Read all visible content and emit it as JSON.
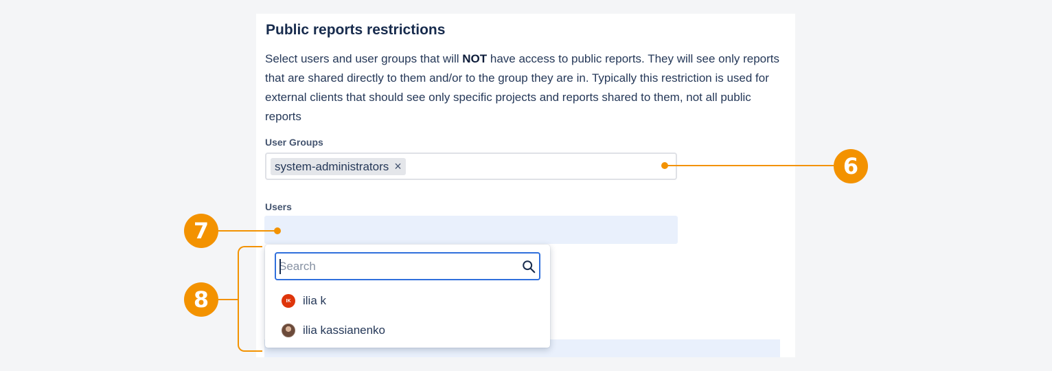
{
  "section": {
    "title": "Public reports restrictions",
    "desc_part1": "Select users and user groups that will ",
    "desc_bold": "NOT",
    "desc_part2": " have access to public reports. They will see only reports that are shared directly to them and/or to the group they are in. Typically this restriction is used for external clients that should see only specific projects and reports shared to them, not all public reports"
  },
  "user_groups": {
    "label": "User Groups",
    "tags": [
      "system-administrators"
    ],
    "remove_symbol": "×"
  },
  "users": {
    "label": "Users",
    "value": ""
  },
  "dropdown": {
    "search_placeholder": "Search",
    "options": [
      {
        "avatar_initials": "IK",
        "name": "ilia k"
      },
      {
        "avatar_initials": "",
        "name": "ilia kassianenko"
      }
    ]
  },
  "callouts": [
    "6",
    "7",
    "8"
  ],
  "colors": {
    "accent": "#f39200",
    "focus_border": "#2f6fdc",
    "input_bg": "#e9f0fc",
    "avatar_red": "#de350b"
  }
}
